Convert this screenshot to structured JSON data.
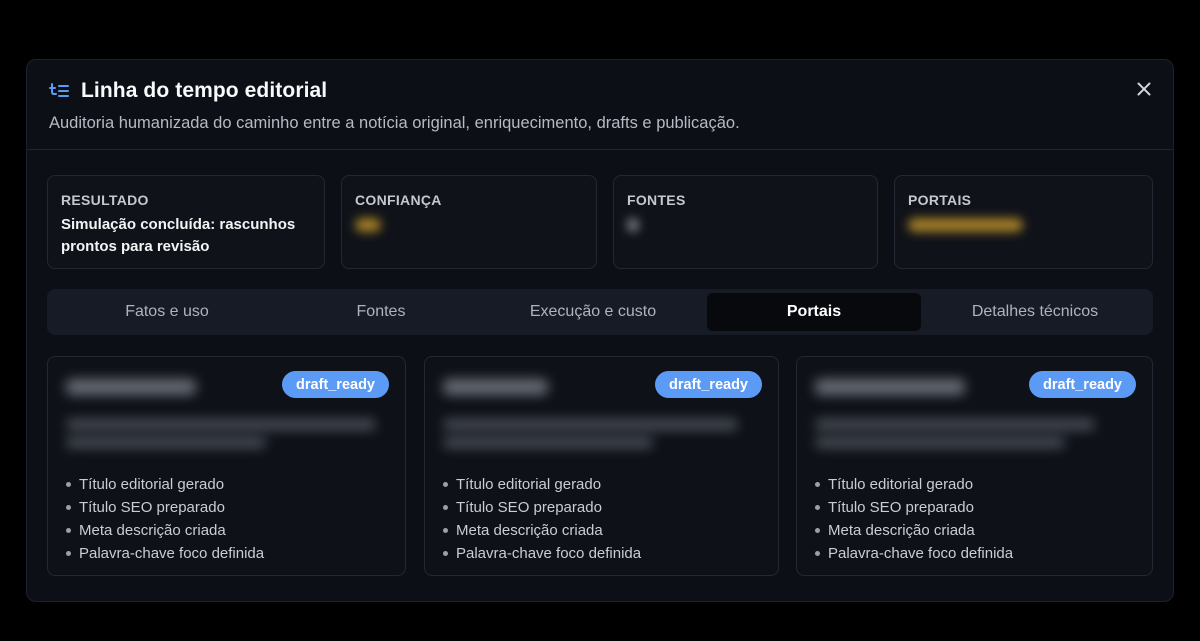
{
  "modal": {
    "title": "Linha do tempo editorial",
    "subtitle": "Auditoria humanizada do caminho entre a notícia original, enriquecimento, drafts e publicação.",
    "icon": "timeline-list-icon",
    "close_icon": "close-icon"
  },
  "stats": [
    {
      "label": "RESULTADO",
      "value": "Simulação concluída: rascunhos prontos para revisão"
    },
    {
      "label": "CONFIANÇA"
    },
    {
      "label": "FONTES"
    },
    {
      "label": "PORTAIS"
    }
  ],
  "tabs": [
    {
      "label": "Fatos e uso",
      "active": false
    },
    {
      "label": "Fontes",
      "active": false
    },
    {
      "label": "Execução e custo",
      "active": false
    },
    {
      "label": "Portais",
      "active": true
    },
    {
      "label": "Detalhes técnicos",
      "active": false
    }
  ],
  "cards": [
    {
      "status": "draft_ready",
      "items": [
        "Título editorial gerado",
        "Título SEO preparado",
        "Meta descrição criada",
        "Palavra-chave foco definida"
      ]
    },
    {
      "status": "draft_ready",
      "items": [
        "Título editorial gerado",
        "Título SEO preparado",
        "Meta descrição criada",
        "Palavra-chave foco definida"
      ]
    },
    {
      "status": "draft_ready",
      "items": [
        "Título editorial gerado",
        "Título SEO preparado",
        "Meta descrição criada",
        "Palavra-chave foco definida"
      ]
    }
  ],
  "colors": {
    "accent": "#5b9bf5",
    "background": "#000000",
    "modal": "#0c0f16",
    "redacted_highlight": "#d3a22c"
  }
}
